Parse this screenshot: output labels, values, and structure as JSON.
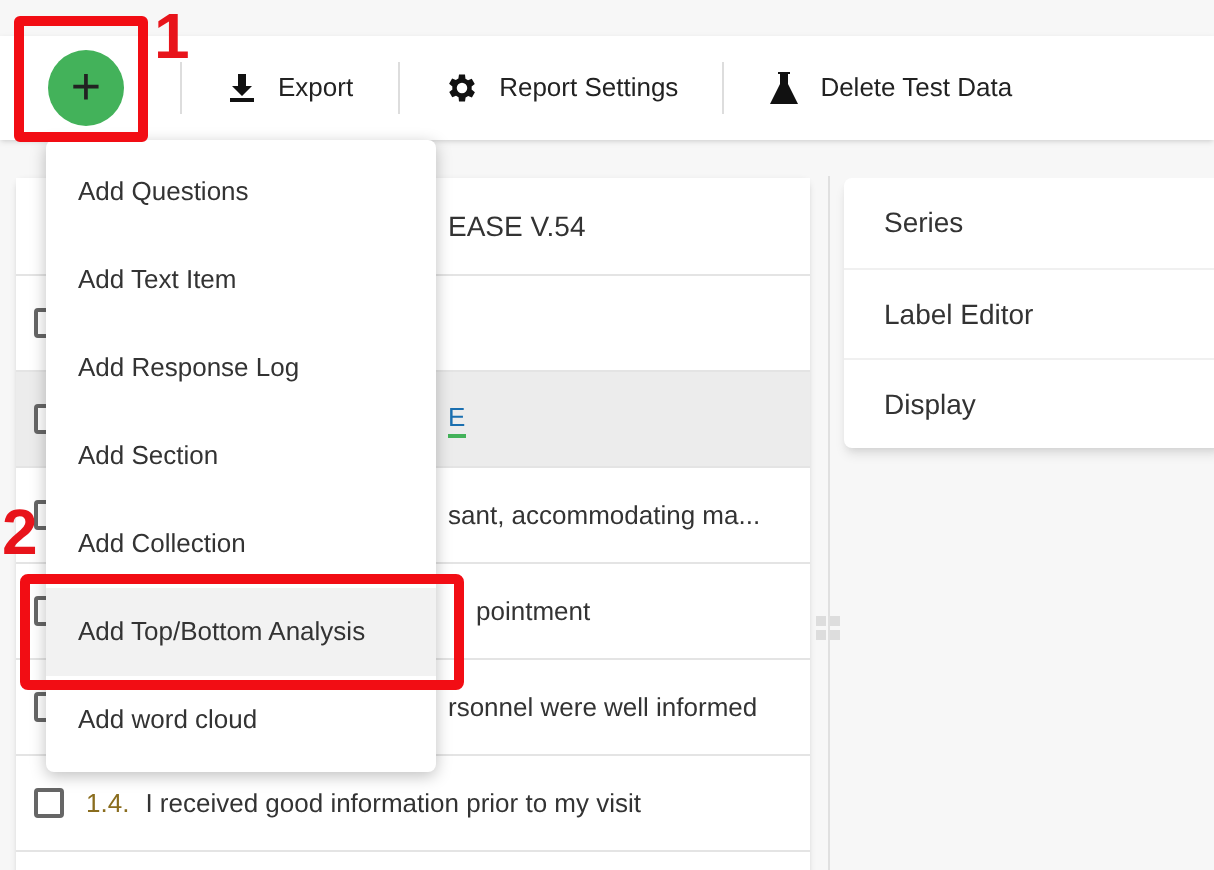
{
  "toolbar": {
    "add_button": {
      "label": "+"
    },
    "actions": [
      {
        "label": "Export",
        "kind": "download"
      },
      {
        "label": "Report Settings",
        "kind": "gear"
      },
      {
        "label": "Delete Test Data",
        "kind": "flask"
      }
    ]
  },
  "add_menu": {
    "items": [
      {
        "label": "Add Questions",
        "selected": false
      },
      {
        "label": "Add Text Item",
        "selected": false
      },
      {
        "label": "Add Response Log",
        "selected": false
      },
      {
        "label": "Add Section",
        "selected": false
      },
      {
        "label": "Add Collection",
        "selected": false
      },
      {
        "label": "Add Top/Bottom Analysis",
        "selected": true
      },
      {
        "label": "Add word cloud",
        "selected": false
      }
    ]
  },
  "items": [
    {
      "kind": "heading",
      "text": "EASE V.54",
      "highlighted": false
    },
    {
      "kind": "blank",
      "highlighted": false,
      "checked": false
    },
    {
      "kind": "link",
      "text": "E",
      "highlighted": true,
      "checked": false
    },
    {
      "kind": "partial",
      "text": "sant, accommodating ma...",
      "highlighted": false,
      "checked": false
    },
    {
      "kind": "framed",
      "text": "pointment",
      "highlighted": false,
      "checked": false
    },
    {
      "kind": "partial",
      "text": "rsonnel were well informed",
      "highlighted": false,
      "checked": false
    },
    {
      "kind": "question",
      "number": "1.4.",
      "text": "I received good information prior to my visit",
      "highlighted": false,
      "checked": false
    }
  ],
  "side_panel": {
    "sections": [
      {
        "label": "Series"
      },
      {
        "label": "Label Editor"
      },
      {
        "label": "Display"
      }
    ]
  },
  "annotations": [
    {
      "label": "1"
    },
    {
      "label": "2"
    }
  ]
}
